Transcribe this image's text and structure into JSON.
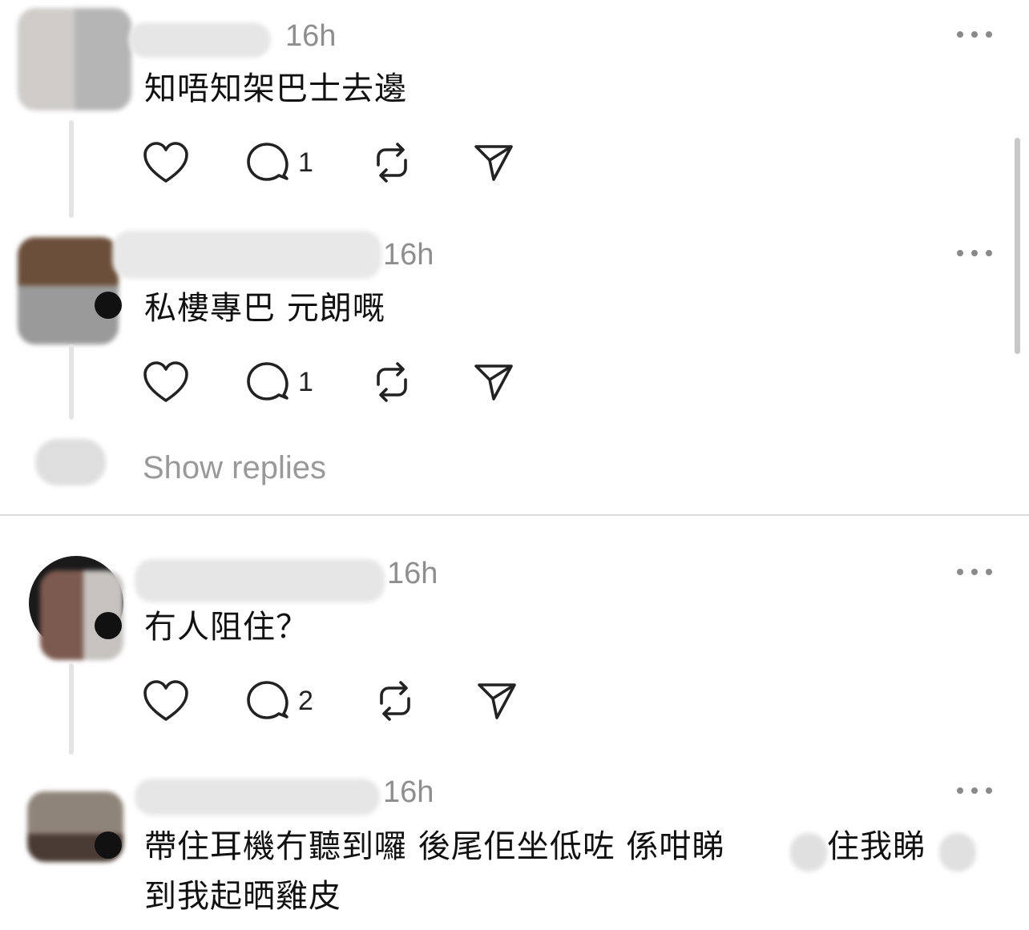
{
  "comments": [
    {
      "time": "16h",
      "text": "知唔知架巴士去邊",
      "reply_count": "1"
    },
    {
      "time": "16h",
      "text": "私樓專巴 元朗嘅",
      "reply_count": "1"
    },
    {
      "time": "16h",
      "text": "冇人阻住？",
      "reply_count": "2"
    },
    {
      "time": "16h",
      "text_line1": "帶住耳機冇聽到囉 後尾佢坐低咗 係咁睇",
      "text_line1b": "住我睇",
      "text_line2": "到我起晒雞皮"
    }
  ],
  "show_replies_label": "Show replies",
  "icons": [
    "heart-icon",
    "comment-icon",
    "repost-icon",
    "share-icon",
    "more-icon"
  ],
  "colors": {
    "meta_text": "#8e8e8e",
    "body_text": "#111111",
    "divider": "#dcdcdc"
  }
}
